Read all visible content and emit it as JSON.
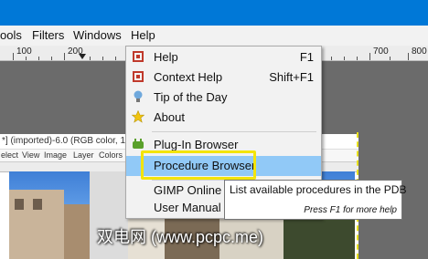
{
  "menubar": {
    "items": [
      "ools",
      "Filters",
      "Windows",
      "Help"
    ]
  },
  "ruler": {
    "numbers": [
      "100",
      "200",
      "300",
      "400",
      "500",
      "600",
      "700",
      "800"
    ]
  },
  "help_menu": {
    "items": [
      {
        "label": "Help",
        "shortcut": "F1",
        "icon": "help-book-icon"
      },
      {
        "label": "Context Help",
        "shortcut": "Shift+F1",
        "icon": "context-help-icon"
      },
      {
        "label": "Tip of the Day",
        "shortcut": "",
        "icon": "lightbulb-icon"
      },
      {
        "label": "About",
        "shortcut": "",
        "icon": "star-icon"
      },
      {
        "label": "Plug-In Browser",
        "shortcut": "",
        "icon": "plugin-icon"
      },
      {
        "label": "Procedure Browser",
        "shortcut": "",
        "icon": ""
      },
      {
        "label": "GIMP Online",
        "shortcut": "",
        "icon": ""
      },
      {
        "label": "User Manual",
        "shortcut": "",
        "icon": ""
      }
    ]
  },
  "tooltip": {
    "text": "List available procedures in the PDB",
    "hint": "Press F1 for more help"
  },
  "image_window": {
    "title": "*] (imported)-6.0 (RGB color, 1 layer) 518",
    "menu": [
      "elect",
      "View",
      "Image",
      "Layer",
      "Colors"
    ]
  },
  "watermark": "双电网 (www.pcpc.me)",
  "colors": {
    "titlebar": "#0078d7",
    "menu_highlight": "#91c9f7",
    "callout": "#f3e40b"
  }
}
